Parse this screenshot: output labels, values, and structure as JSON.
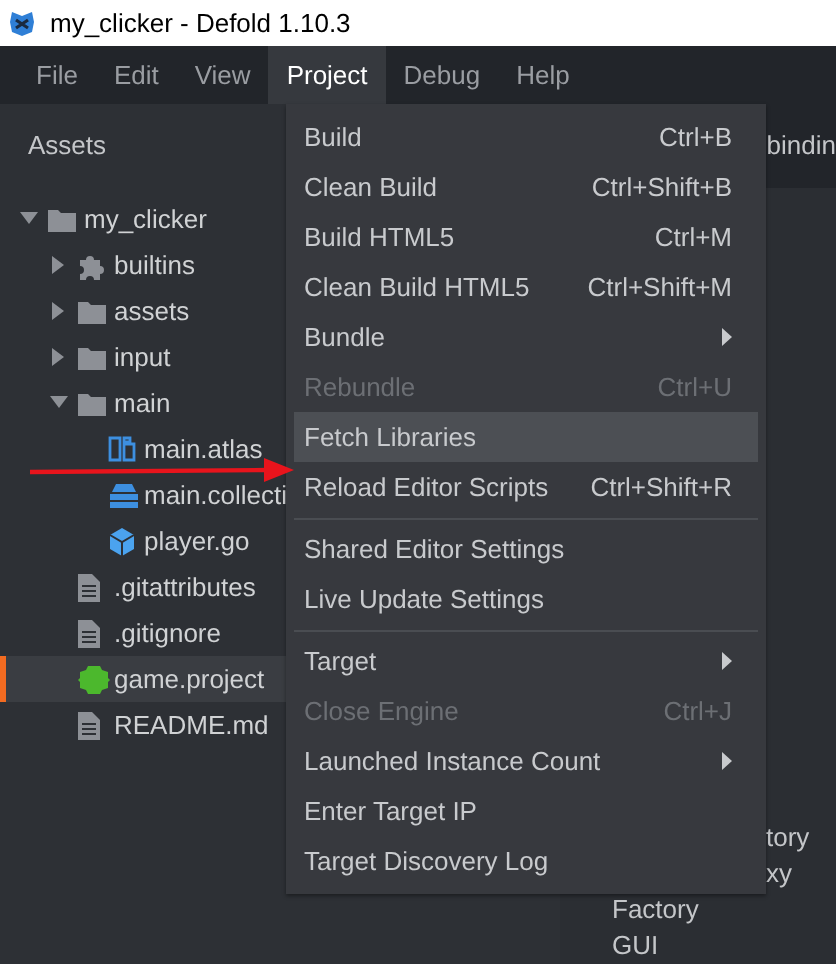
{
  "window": {
    "title": "my_clicker - Defold 1.10.3"
  },
  "menu_bar": [
    {
      "label": "File",
      "selected": false
    },
    {
      "label": "Edit",
      "selected": false
    },
    {
      "label": "View",
      "selected": false
    },
    {
      "label": "Project",
      "selected": true
    },
    {
      "label": "Debug",
      "selected": false
    },
    {
      "label": "Help",
      "selected": false
    }
  ],
  "assets_panel": {
    "title": "Assets",
    "tree": [
      {
        "label": "my_clicker",
        "kind": "folder",
        "expanded": true,
        "selected": false,
        "children": [
          {
            "label": "builtins",
            "kind": "puzzle",
            "expanded": false,
            "selected": false
          },
          {
            "label": "assets",
            "kind": "folder",
            "expanded": false,
            "selected": false
          },
          {
            "label": "input",
            "kind": "folder",
            "expanded": false,
            "selected": false
          },
          {
            "label": "main",
            "kind": "folder",
            "expanded": true,
            "selected": false,
            "children": [
              {
                "label": "main.atlas",
                "kind": "atlas",
                "selected": false
              },
              {
                "label": "main.collecti",
                "kind": "collection",
                "selected": false
              },
              {
                "label": "player.go",
                "kind": "cube",
                "selected": false
              }
            ]
          },
          {
            "label": ".gitattributes",
            "kind": "file",
            "selected": false
          },
          {
            "label": ".gitignore",
            "kind": "file",
            "selected": false
          },
          {
            "label": "game.project",
            "kind": "project",
            "selected": true
          },
          {
            "label": "README.md",
            "kind": "file",
            "selected": false
          }
        ]
      }
    ]
  },
  "background_pane": {
    "tab": "bindin",
    "items": [
      {
        "label": "tory",
        "kind": "partial"
      },
      {
        "label": "xy",
        "kind": "partial"
      },
      {
        "label": "Factory",
        "kind": "full"
      },
      {
        "label": "GUI",
        "kind": "full"
      }
    ]
  },
  "project_menu": [
    {
      "kind": "item",
      "label": "Build",
      "shortcut": "Ctrl+B",
      "disabled": false,
      "selected": false,
      "submenu": false
    },
    {
      "kind": "item",
      "label": "Clean Build",
      "shortcut": "Ctrl+Shift+B",
      "disabled": false,
      "selected": false,
      "submenu": false
    },
    {
      "kind": "item",
      "label": "Build HTML5",
      "shortcut": "Ctrl+M",
      "disabled": false,
      "selected": false,
      "submenu": false
    },
    {
      "kind": "item",
      "label": "Clean Build HTML5",
      "shortcut": "Ctrl+Shift+M",
      "disabled": false,
      "selected": false,
      "submenu": false
    },
    {
      "kind": "item",
      "label": "Bundle",
      "disabled": false,
      "selected": false,
      "submenu": true
    },
    {
      "kind": "item",
      "label": "Rebundle",
      "shortcut": "Ctrl+U",
      "disabled": true,
      "selected": false,
      "submenu": false
    },
    {
      "kind": "item",
      "label": "Fetch Libraries",
      "disabled": false,
      "selected": true,
      "submenu": false
    },
    {
      "kind": "item",
      "label": "Reload Editor Scripts",
      "shortcut": "Ctrl+Shift+R",
      "disabled": false,
      "selected": false,
      "submenu": false
    },
    {
      "kind": "separator"
    },
    {
      "kind": "item",
      "label": "Shared Editor Settings",
      "disabled": false,
      "selected": false,
      "submenu": false
    },
    {
      "kind": "item",
      "label": "Live Update Settings",
      "disabled": false,
      "selected": false,
      "submenu": false
    },
    {
      "kind": "separator"
    },
    {
      "kind": "item",
      "label": "Target",
      "disabled": false,
      "selected": false,
      "submenu": true
    },
    {
      "kind": "item",
      "label": "Close Engine",
      "shortcut": "Ctrl+J",
      "disabled": true,
      "selected": false,
      "submenu": false
    },
    {
      "kind": "item",
      "label": "Launched Instance Count",
      "disabled": false,
      "selected": false,
      "submenu": true
    },
    {
      "kind": "item",
      "label": "Enter Target IP",
      "disabled": false,
      "selected": false,
      "submenu": false
    },
    {
      "kind": "item",
      "label": "Target Discovery Log",
      "disabled": false,
      "selected": false,
      "submenu": false
    }
  ]
}
